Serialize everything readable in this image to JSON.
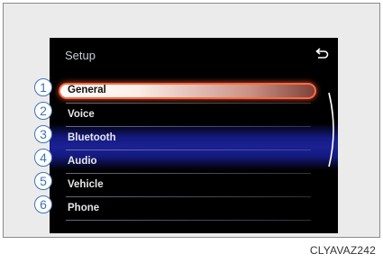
{
  "screen": {
    "title": "Setup",
    "menu_items": [
      {
        "label": "General",
        "selected": true
      },
      {
        "label": "Voice"
      },
      {
        "label": "Bluetooth"
      },
      {
        "label": "Audio"
      },
      {
        "label": "Vehicle"
      },
      {
        "label": "Phone"
      }
    ]
  },
  "callouts": [
    "1",
    "2",
    "3",
    "4",
    "5",
    "6"
  ],
  "caption": "CLYAVAZ242",
  "icons": {
    "back": "back-arrow-icon",
    "scroll": "scroll-arc-indicator"
  },
  "colors": {
    "highlight_border": "#ff6a42",
    "band": "#1b2194",
    "callout": "#3f74b8"
  }
}
